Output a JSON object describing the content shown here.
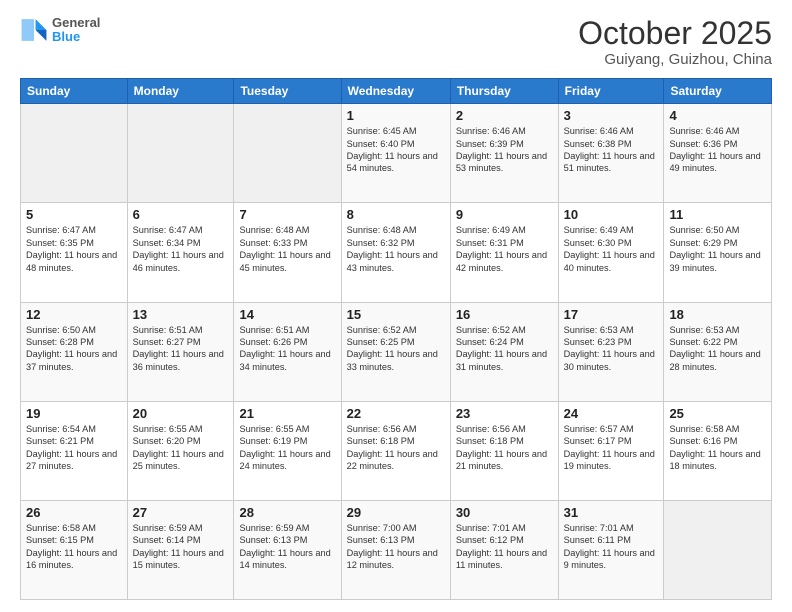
{
  "logo": {
    "line1": "General",
    "line2": "Blue"
  },
  "title": "October 2025",
  "subtitle": "Guiyang, Guizhou, China",
  "weekdays": [
    "Sunday",
    "Monday",
    "Tuesday",
    "Wednesday",
    "Thursday",
    "Friday",
    "Saturday"
  ],
  "weeks": [
    [
      {
        "day": "",
        "sunrise": "",
        "sunset": "",
        "daylight": ""
      },
      {
        "day": "",
        "sunrise": "",
        "sunset": "",
        "daylight": ""
      },
      {
        "day": "",
        "sunrise": "",
        "sunset": "",
        "daylight": ""
      },
      {
        "day": "1",
        "sunrise": "Sunrise: 6:45 AM",
        "sunset": "Sunset: 6:40 PM",
        "daylight": "Daylight: 11 hours and 54 minutes."
      },
      {
        "day": "2",
        "sunrise": "Sunrise: 6:46 AM",
        "sunset": "Sunset: 6:39 PM",
        "daylight": "Daylight: 11 hours and 53 minutes."
      },
      {
        "day": "3",
        "sunrise": "Sunrise: 6:46 AM",
        "sunset": "Sunset: 6:38 PM",
        "daylight": "Daylight: 11 hours and 51 minutes."
      },
      {
        "day": "4",
        "sunrise": "Sunrise: 6:46 AM",
        "sunset": "Sunset: 6:36 PM",
        "daylight": "Daylight: 11 hours and 49 minutes."
      }
    ],
    [
      {
        "day": "5",
        "sunrise": "Sunrise: 6:47 AM",
        "sunset": "Sunset: 6:35 PM",
        "daylight": "Daylight: 11 hours and 48 minutes."
      },
      {
        "day": "6",
        "sunrise": "Sunrise: 6:47 AM",
        "sunset": "Sunset: 6:34 PM",
        "daylight": "Daylight: 11 hours and 46 minutes."
      },
      {
        "day": "7",
        "sunrise": "Sunrise: 6:48 AM",
        "sunset": "Sunset: 6:33 PM",
        "daylight": "Daylight: 11 hours and 45 minutes."
      },
      {
        "day": "8",
        "sunrise": "Sunrise: 6:48 AM",
        "sunset": "Sunset: 6:32 PM",
        "daylight": "Daylight: 11 hours and 43 minutes."
      },
      {
        "day": "9",
        "sunrise": "Sunrise: 6:49 AM",
        "sunset": "Sunset: 6:31 PM",
        "daylight": "Daylight: 11 hours and 42 minutes."
      },
      {
        "day": "10",
        "sunrise": "Sunrise: 6:49 AM",
        "sunset": "Sunset: 6:30 PM",
        "daylight": "Daylight: 11 hours and 40 minutes."
      },
      {
        "day": "11",
        "sunrise": "Sunrise: 6:50 AM",
        "sunset": "Sunset: 6:29 PM",
        "daylight": "Daylight: 11 hours and 39 minutes."
      }
    ],
    [
      {
        "day": "12",
        "sunrise": "Sunrise: 6:50 AM",
        "sunset": "Sunset: 6:28 PM",
        "daylight": "Daylight: 11 hours and 37 minutes."
      },
      {
        "day": "13",
        "sunrise": "Sunrise: 6:51 AM",
        "sunset": "Sunset: 6:27 PM",
        "daylight": "Daylight: 11 hours and 36 minutes."
      },
      {
        "day": "14",
        "sunrise": "Sunrise: 6:51 AM",
        "sunset": "Sunset: 6:26 PM",
        "daylight": "Daylight: 11 hours and 34 minutes."
      },
      {
        "day": "15",
        "sunrise": "Sunrise: 6:52 AM",
        "sunset": "Sunset: 6:25 PM",
        "daylight": "Daylight: 11 hours and 33 minutes."
      },
      {
        "day": "16",
        "sunrise": "Sunrise: 6:52 AM",
        "sunset": "Sunset: 6:24 PM",
        "daylight": "Daylight: 11 hours and 31 minutes."
      },
      {
        "day": "17",
        "sunrise": "Sunrise: 6:53 AM",
        "sunset": "Sunset: 6:23 PM",
        "daylight": "Daylight: 11 hours and 30 minutes."
      },
      {
        "day": "18",
        "sunrise": "Sunrise: 6:53 AM",
        "sunset": "Sunset: 6:22 PM",
        "daylight": "Daylight: 11 hours and 28 minutes."
      }
    ],
    [
      {
        "day": "19",
        "sunrise": "Sunrise: 6:54 AM",
        "sunset": "Sunset: 6:21 PM",
        "daylight": "Daylight: 11 hours and 27 minutes."
      },
      {
        "day": "20",
        "sunrise": "Sunrise: 6:55 AM",
        "sunset": "Sunset: 6:20 PM",
        "daylight": "Daylight: 11 hours and 25 minutes."
      },
      {
        "day": "21",
        "sunrise": "Sunrise: 6:55 AM",
        "sunset": "Sunset: 6:19 PM",
        "daylight": "Daylight: 11 hours and 24 minutes."
      },
      {
        "day": "22",
        "sunrise": "Sunrise: 6:56 AM",
        "sunset": "Sunset: 6:18 PM",
        "daylight": "Daylight: 11 hours and 22 minutes."
      },
      {
        "day": "23",
        "sunrise": "Sunrise: 6:56 AM",
        "sunset": "Sunset: 6:18 PM",
        "daylight": "Daylight: 11 hours and 21 minutes."
      },
      {
        "day": "24",
        "sunrise": "Sunrise: 6:57 AM",
        "sunset": "Sunset: 6:17 PM",
        "daylight": "Daylight: 11 hours and 19 minutes."
      },
      {
        "day": "25",
        "sunrise": "Sunrise: 6:58 AM",
        "sunset": "Sunset: 6:16 PM",
        "daylight": "Daylight: 11 hours and 18 minutes."
      }
    ],
    [
      {
        "day": "26",
        "sunrise": "Sunrise: 6:58 AM",
        "sunset": "Sunset: 6:15 PM",
        "daylight": "Daylight: 11 hours and 16 minutes."
      },
      {
        "day": "27",
        "sunrise": "Sunrise: 6:59 AM",
        "sunset": "Sunset: 6:14 PM",
        "daylight": "Daylight: 11 hours and 15 minutes."
      },
      {
        "day": "28",
        "sunrise": "Sunrise: 6:59 AM",
        "sunset": "Sunset: 6:13 PM",
        "daylight": "Daylight: 11 hours and 14 minutes."
      },
      {
        "day": "29",
        "sunrise": "Sunrise: 7:00 AM",
        "sunset": "Sunset: 6:13 PM",
        "daylight": "Daylight: 11 hours and 12 minutes."
      },
      {
        "day": "30",
        "sunrise": "Sunrise: 7:01 AM",
        "sunset": "Sunset: 6:12 PM",
        "daylight": "Daylight: 11 hours and 11 minutes."
      },
      {
        "day": "31",
        "sunrise": "Sunrise: 7:01 AM",
        "sunset": "Sunset: 6:11 PM",
        "daylight": "Daylight: 11 hours and 9 minutes."
      },
      {
        "day": "",
        "sunrise": "",
        "sunset": "",
        "daylight": ""
      }
    ]
  ]
}
